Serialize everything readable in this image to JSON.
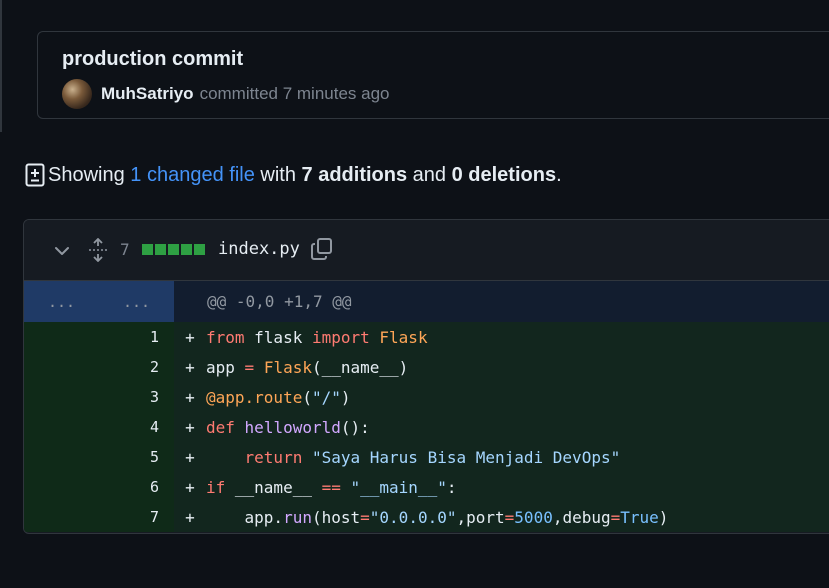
{
  "commit": {
    "title": "production commit",
    "author": "MuhSatriyo",
    "action": "committed",
    "time": "7 minutes ago"
  },
  "summary": {
    "prefix": "Showing",
    "changed": "1 changed file",
    "with": "with",
    "additions": "7 additions",
    "and": "and",
    "deletions": "0 deletions",
    "end": "."
  },
  "file": {
    "additions_count": "7",
    "name": "index.py",
    "diffstat_blocks": 5
  },
  "hunk": {
    "old_placeholder": "...",
    "new_placeholder": "...",
    "header": "@@ -0,0 +1,7 @@"
  },
  "lines": [
    {
      "n": "1",
      "sign": "+",
      "tokens": [
        [
          "k",
          "from"
        ],
        [
          "plain",
          " flask "
        ],
        [
          "k",
          "import"
        ],
        [
          "plain",
          " "
        ],
        [
          "cls",
          "Flask"
        ]
      ]
    },
    {
      "n": "2",
      "sign": "+",
      "tokens": [
        [
          "plain",
          "app "
        ],
        [
          "op",
          "="
        ],
        [
          "plain",
          " "
        ],
        [
          "cls",
          "Flask"
        ],
        [
          "plain",
          "(__name__)"
        ]
      ]
    },
    {
      "n": "3",
      "sign": "+",
      "tokens": [
        [
          "cls",
          "@app.route"
        ],
        [
          "plain",
          "("
        ],
        [
          "str",
          "\"/\""
        ],
        [
          "plain",
          ")"
        ]
      ]
    },
    {
      "n": "4",
      "sign": "+",
      "tokens": [
        [
          "k",
          "def"
        ],
        [
          "plain",
          " "
        ],
        [
          "fn",
          "helloworld"
        ],
        [
          "plain",
          "():"
        ]
      ]
    },
    {
      "n": "5",
      "sign": "+",
      "tokens": [
        [
          "plain",
          "    "
        ],
        [
          "k",
          "return"
        ],
        [
          "plain",
          " "
        ],
        [
          "str",
          "\"Saya Harus Bisa Menjadi DevOps\""
        ]
      ]
    },
    {
      "n": "6",
      "sign": "+",
      "tokens": [
        [
          "k",
          "if"
        ],
        [
          "plain",
          " __name__ "
        ],
        [
          "op",
          "=="
        ],
        [
          "plain",
          " "
        ],
        [
          "str",
          "\"__main__\""
        ],
        [
          "plain",
          ":"
        ]
      ]
    },
    {
      "n": "7",
      "sign": "+",
      "tokens": [
        [
          "plain",
          "    app."
        ],
        [
          "fn",
          "run"
        ],
        [
          "plain",
          "(host"
        ],
        [
          "op",
          "="
        ],
        [
          "str",
          "\"0.0.0.0\""
        ],
        [
          "plain",
          ",port"
        ],
        [
          "op",
          "="
        ],
        [
          "num-lit",
          "5000"
        ],
        [
          "plain",
          ",debug"
        ],
        [
          "op",
          "="
        ],
        [
          "num-lit",
          "True"
        ],
        [
          "plain",
          ")"
        ]
      ]
    }
  ],
  "colors": {
    "background": "#0d1117",
    "link": "#4493f8",
    "addition_green": "#2ea043",
    "hunk_blue": "#1f3a66"
  },
  "icons": [
    "avatar",
    "diff-added-icon",
    "chevron-down-icon",
    "unfold-icon",
    "copy-icon"
  ]
}
